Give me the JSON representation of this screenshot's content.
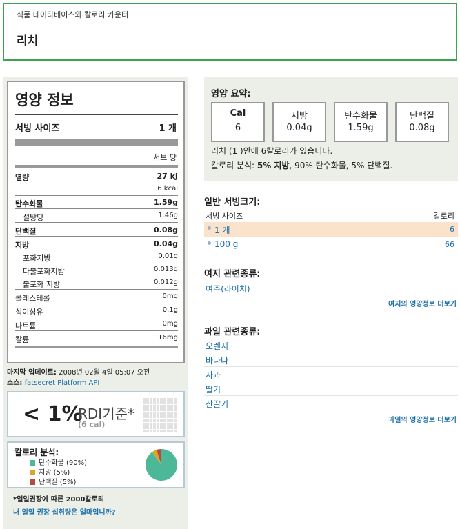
{
  "header": {
    "breadcrumb": "식품 데이타베이스와 칼로리 카운터",
    "title": "리치"
  },
  "nutrition_facts": {
    "title": "영양 정보",
    "serving_size_label": "서빙 사이즈",
    "serving_size_value": "1 개",
    "per_label": "서브 당",
    "energy_label": "열량",
    "energy_kj": "27 kJ",
    "energy_kcal": "6 kcal",
    "rows": [
      {
        "label": "탄수화물",
        "value": "1.59g"
      },
      {
        "label": "설탕당",
        "value": "1.46g"
      },
      {
        "label": "단백질",
        "value": "0.08g"
      },
      {
        "label": "지방",
        "value": "0.04g"
      },
      {
        "label": "포화지방",
        "value": "0.01g"
      },
      {
        "label": "다불포화지방",
        "value": "0.013g"
      },
      {
        "label": "불포화 지방",
        "value": "0.012g"
      },
      {
        "label": "콜레스테롤",
        "value": "0mg"
      },
      {
        "label": "식이섬유",
        "value": "0.1g"
      },
      {
        "label": "나트륨",
        "value": "0mg"
      },
      {
        "label": "칼륨",
        "value": "16mg"
      }
    ]
  },
  "meta": {
    "updated_label": "마지막 업데이트:",
    "updated_value": "2008년 02월 4일 05:07 오전",
    "source_label": "소스:",
    "source_link": "fatsecret Platform API"
  },
  "rdi": {
    "percent": "< 1%",
    "label": "RDI기준*",
    "cal": "(6 cal)"
  },
  "calorie_breakdown": {
    "title": "칼로리 분석:",
    "items": [
      {
        "label": "탄수화물 (90%)",
        "percent": 90,
        "color": "#4db897"
      },
      {
        "label": "지방 (5%)",
        "percent": 5,
        "color": "#d9a62b"
      },
      {
        "label": "단백질 (5%)",
        "percent": 5,
        "color": "#b34c3c"
      }
    ]
  },
  "footnote": {
    "note": "*일일권장에 따른 2000칼로리",
    "link": "내 일일 권장 섭취량은 얼마입니까?"
  },
  "summary": {
    "title": "영양 요약:",
    "boxes": [
      {
        "label": "Cal",
        "value": "6"
      },
      {
        "label": "지방",
        "value": "0.04g"
      },
      {
        "label": "탄수화물",
        "value": "1.59g"
      },
      {
        "label": "단백질",
        "value": "0.08g"
      }
    ],
    "line1": "리치 (1 )안에 6칼로리가 있습니다.",
    "line2_prefix": "칼로리 분석: ",
    "line2_bold": "5% 지방",
    "line2_rest": ", 90% 탄수화물, 5% 단백질."
  },
  "servings": {
    "title": "일반 서빙크기:",
    "col_size": "서빙 사이즈",
    "col_cal": "칼로리",
    "rows": [
      {
        "size": "1 개",
        "cal": "6"
      },
      {
        "size": "100 g",
        "cal": "66"
      }
    ]
  },
  "related_lychee": {
    "title": "여지 관련종류:",
    "items": [
      "여주(라이치)"
    ],
    "more": "여지의 영양정보 더보기"
  },
  "related_fruit": {
    "title": "과일 관련종류:",
    "items": [
      "오렌지",
      "바나나",
      "사과",
      "딸기",
      "산딸기"
    ],
    "more": "과일의 영양정보 더보기"
  }
}
